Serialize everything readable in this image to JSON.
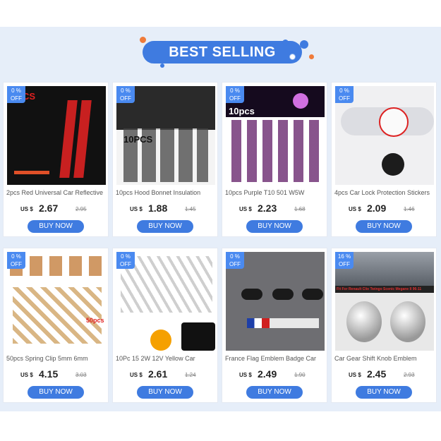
{
  "banner": {
    "title": "BEST SELLING"
  },
  "products": [
    {
      "badge_pct": "0 %",
      "badge_off": "OFF",
      "title": "2pcs Red Universal Car Reflective",
      "currency": "US $",
      "price": "2.67",
      "old_price": "2.95",
      "button": "BUY NOW",
      "image_caption": "CS"
    },
    {
      "badge_pct": "0 %",
      "badge_off": "OFF",
      "title": "10pcs Hood Bonnet Insulation",
      "currency": "US $",
      "price": "1.88",
      "old_price": "1.45",
      "button": "BUY NOW",
      "image_caption": "10PCS"
    },
    {
      "badge_pct": "0 %",
      "badge_off": "OFF",
      "title": "10pcs Purple T10 501 W5W",
      "currency": "US $",
      "price": "2.23",
      "old_price": "1.68",
      "button": "BUY NOW",
      "image_caption": "10pcs"
    },
    {
      "badge_pct": "0 %",
      "badge_off": "OFF",
      "title": "4pcs Car Lock Protection Stickers",
      "currency": "US $",
      "price": "2.09",
      "old_price": "1.46",
      "button": "BUY NOW",
      "image_caption": ""
    },
    {
      "badge_pct": "0 %",
      "badge_off": "OFF",
      "title": "50pcs Spring Clip 5mm 6mm",
      "currency": "US $",
      "price": "4.15",
      "old_price": "3.03",
      "button": "BUY NOW",
      "image_caption": "50pcs"
    },
    {
      "badge_pct": "0 %",
      "badge_off": "OFF",
      "title": "10Pc 15 2W 12V Yellow Car",
      "currency": "US $",
      "price": "2.61",
      "old_price": "1.24",
      "button": "BUY NOW",
      "image_caption": ""
    },
    {
      "badge_pct": "0 %",
      "badge_off": "OFF",
      "title": "France Flag Emblem Badge Car",
      "currency": "US $",
      "price": "2.49",
      "old_price": "1.90",
      "button": "BUY NOW",
      "image_caption": ""
    },
    {
      "badge_pct": "16 %",
      "badge_off": "OFF",
      "title": "Car Gear Shift Knob Emblem",
      "currency": "US $",
      "price": "2.45",
      "old_price": "2.93",
      "button": "BUY NOW",
      "image_caption": "Fit For Renault Clio Twingo Scenic Megane II 96-11"
    }
  ],
  "colors": {
    "accent": "#3f7be0",
    "badge": "#4a8af0",
    "background": "#e6eef9"
  }
}
